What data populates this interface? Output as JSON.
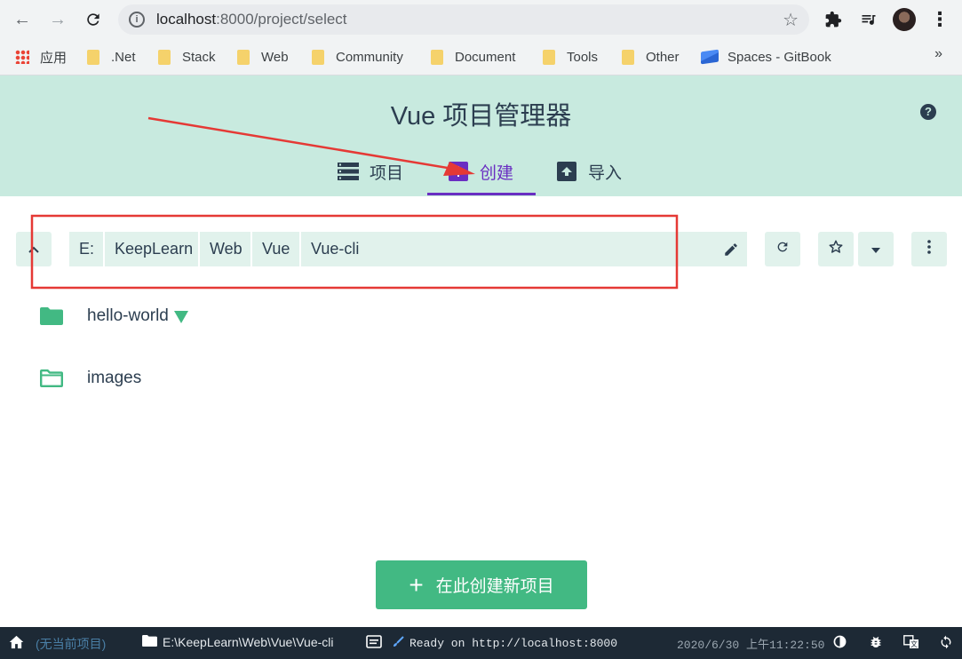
{
  "browser": {
    "url_host": "localhost",
    "url_rest": ":8000/project/select",
    "bookmarks": [
      {
        "label": "应用",
        "icon": "apps-grid-icon"
      },
      {
        "label": ".Net",
        "icon": "folder-icon"
      },
      {
        "label": "Stack",
        "icon": "folder-icon"
      },
      {
        "label": "Web",
        "icon": "folder-icon"
      },
      {
        "label": "Community",
        "icon": "folder-icon"
      },
      {
        "label": "Document",
        "icon": "folder-icon"
      },
      {
        "label": "Tools",
        "icon": "folder-icon"
      },
      {
        "label": "Other",
        "icon": "folder-icon"
      },
      {
        "label": "Spaces - GitBook",
        "icon": "gitbook-icon"
      }
    ],
    "more_bookmarks": "»"
  },
  "app": {
    "title": "Vue 项目管理器",
    "help": "?",
    "tabs": [
      {
        "label": "项目",
        "icon": "list-icon",
        "active": false
      },
      {
        "label": "创建",
        "icon": "add-box-icon",
        "active": true
      },
      {
        "label": "导入",
        "icon": "unarchive-icon",
        "active": false
      }
    ],
    "colors": {
      "header_bg": "#c8eadf",
      "accent": "#42b983",
      "active_tab": "#6a2ec2",
      "annotation": "#e53935"
    }
  },
  "path_bar": {
    "crumbs": [
      "E:",
      "KeepLearn",
      "Web",
      "Vue",
      "Vue-cli"
    ]
  },
  "folders": [
    {
      "name": "hello-world",
      "icon": "folder-filled-icon",
      "is_vue_project": true
    },
    {
      "name": "images",
      "icon": "folder-outline-icon",
      "is_vue_project": false
    }
  ],
  "create_button": {
    "label": "在此创建新项目"
  },
  "statusbar": {
    "no_project": "(无当前项目)",
    "cwd": "E:\\KeepLearn\\Web\\Vue\\Vue-cli",
    "log": "Ready on http://localhost:8000",
    "datetime": "2020/6/30 上午11:22:50"
  }
}
